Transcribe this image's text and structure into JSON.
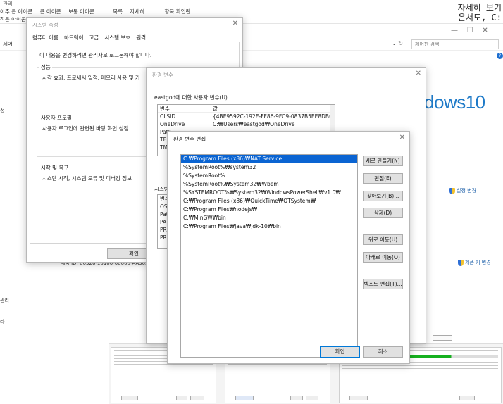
{
  "background": {
    "top_row1": [
      "아주 큰 아이콘",
      "큰 아이콘",
      "보통 아이콘"
    ],
    "top_row1b": [
      "목록",
      "자세히"
    ],
    "top_row1c": "항목 확인란",
    "top_row2": "작은 아이콘",
    "top_right_text": "자세히 보기",
    "top_right_text2": "은서도, C:",
    "top_tiny": "관리",
    "address_label": "제어",
    "search_placeholder": "제어판 검색",
    "windows_logo_text": "dows10",
    "sidebar_items": [
      "정",
      "관리",
      "라"
    ],
    "link_settings_change": "설정 변경",
    "link_product_key": "제품 키 변경",
    "product_id_text": "제품 ID: 00326-10100-00000-AA305"
  },
  "sysprops": {
    "title": "시스템 속성",
    "tabs": [
      "컴퓨터 이름",
      "하드웨어",
      "고급",
      "시스템 보호",
      "원격"
    ],
    "admin_note": "이 내용을 변경하려면 관리자로 로그온해야 합니다.",
    "perf_label": "성능",
    "perf_text": "시각 효과, 프로세서 일정, 메모리 사용 및 가",
    "profile_label": "사용자 프로필",
    "profile_text": "사용자 로그인에 관련된 바탕 화면 설정",
    "startup_label": "시작 및 복구",
    "startup_text": "시스템 시작, 시스템 오류 및 디버깅 정보",
    "ok": "확인"
  },
  "envvars": {
    "title": "환경 변수",
    "user_section": "eastgod에 대한 사용자 변수(U)",
    "col_var": "변수",
    "col_val": "값",
    "user_rows": [
      {
        "name": "CLSID",
        "value": "{4BE9592C-192E-FF86-9FC9-0837B5EE8DB0}"
      },
      {
        "name": "OneDrive",
        "value": "C:₩Users₩eastgod₩OneDrive"
      },
      {
        "name": "Path",
        "value": ""
      },
      {
        "name": "TEM",
        "value": ""
      },
      {
        "name": "TMP",
        "value": ""
      }
    ],
    "sys_section": "시스템",
    "sys_rows": [
      "변수",
      "OS",
      "Path",
      "PATH",
      "PRO",
      "PRO"
    ]
  },
  "editdlg": {
    "title": "환경 변수 편집",
    "paths": [
      "C:₩Program Files (x86)₩NAT Service",
      "%SystemRoot%₩system32",
      "%SystemRoot%",
      "%SystemRoot%₩System32₩Wbem",
      "%SYSTEMROOT%₩System32₩WindowsPowerShell₩v1.0₩",
      "C:₩Program Files (x86)₩QuickTime₩QTSystem₩",
      "C:₩Program Files₩nodejs₩",
      "C:₩MinGW₩bin",
      "C:₩Program Files₩Java₩jdk-10₩bin"
    ],
    "selected_index": 0,
    "btn_new": "새로 만들기(N)",
    "btn_edit": "편집(E)",
    "btn_browse": "찾아보기(B)...",
    "btn_delete": "삭제(D)",
    "btn_up": "위로 이동(U)",
    "btn_down": "아래로 이동(O)",
    "btn_text_edit": "텍스트 편집(T)...",
    "btn_ok": "확인",
    "btn_cancel": "취소"
  }
}
